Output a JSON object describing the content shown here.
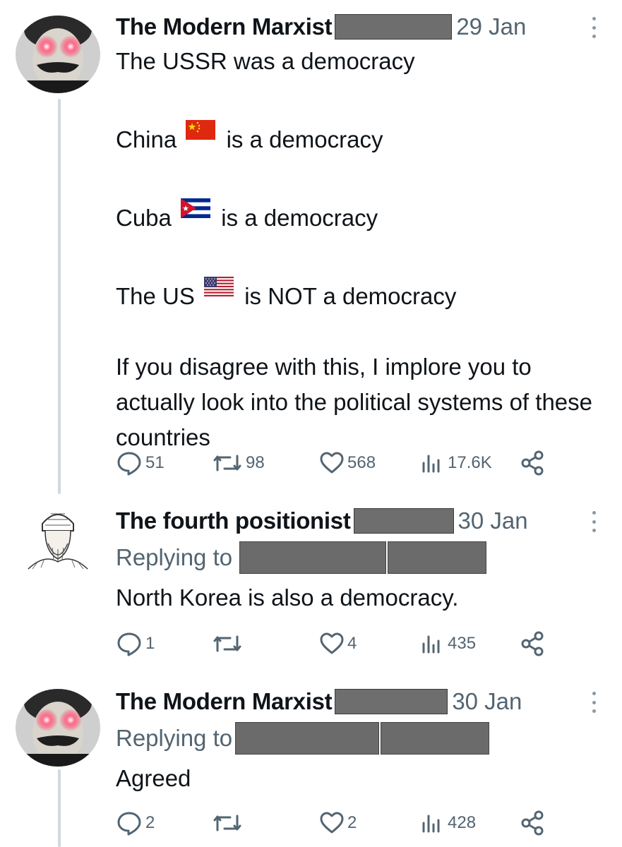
{
  "tweets": [
    {
      "display_name": "The Modern Marxist",
      "date": "29 Jan",
      "lines": [
        "The USSR was a democracy",
        "",
        "China {flag} is a democracy",
        "",
        "Cuba {flag} is a democracy",
        "",
        "The US {flag} is NOT a democracy",
        "",
        "If you disagree with this, I implore you to actually look into the political systems of these countries"
      ],
      "text": {
        "line1": "The USSR was a democracy",
        "china_pre": "China",
        "china_post": "is a democracy",
        "cuba_pre": "Cuba",
        "cuba_post": "is a democracy",
        "us_pre": "The US",
        "us_post": "is NOT a democracy",
        "closing": "If you disagree with this, I implore you to actually look into the political systems of these countries"
      },
      "flags": [
        "china-flag",
        "cuba-flag",
        "us-flag"
      ],
      "actions": {
        "replies": "51",
        "retweets": "98",
        "likes": "568",
        "views": "17.6K"
      }
    },
    {
      "display_name": "The fourth positionist",
      "date": "30 Jan",
      "replying_label": "Replying to",
      "text": "North Korea is also a democracy.",
      "actions": {
        "replies": "1",
        "retweets": "",
        "likes": "4",
        "views": "435"
      }
    },
    {
      "display_name": "The Modern Marxist",
      "date": "30 Jan",
      "replying_label": "Replying to",
      "text": "Agreed",
      "actions": {
        "replies": "2",
        "retweets": "",
        "likes": "2",
        "views": "428"
      }
    }
  ],
  "icons": [
    "reply-icon",
    "retweet-icon",
    "like-icon",
    "views-icon",
    "share-icon",
    "more-icon"
  ],
  "colors": {
    "text": "#0f1419",
    "secondary": "#536471",
    "thread_line": "#cfd9de",
    "redaction": "#6e6e6e"
  }
}
